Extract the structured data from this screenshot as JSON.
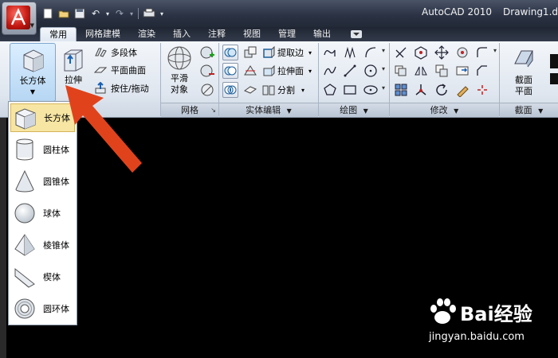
{
  "window": {
    "app_name": "AutoCAD 2010",
    "file_name": "Drawing1.d"
  },
  "ribbon_tabs": [
    "常用",
    "网格建模",
    "渲染",
    "插入",
    "注释",
    "视图",
    "管理",
    "输出"
  ],
  "modeling": {
    "box_label": "长方体",
    "extrude_label": "拉伸",
    "polysolid_label": "多段体",
    "planar_surface_label": "平面曲面",
    "presspull_label": "按住/拖动"
  },
  "mesh": {
    "smooth_line1": "平滑",
    "smooth_line2": "对象",
    "panel_title": "网格"
  },
  "solid_editing": {
    "extract_edges_label": "提取边",
    "extrude_faces_label": "拉伸面",
    "separate_label": "分割",
    "panel_title": "实体编辑"
  },
  "draw": {
    "panel_title": "绘图"
  },
  "modify": {
    "panel_title": "修改"
  },
  "section": {
    "line1": "截面",
    "line2": "平面",
    "panel_title": "截面"
  },
  "dropdown_items": [
    {
      "label": "长方体",
      "icon": "box-icon",
      "selected": true
    },
    {
      "label": "圆柱体",
      "icon": "cylinder-icon"
    },
    {
      "label": "圆锥体",
      "icon": "cone-icon"
    },
    {
      "label": "球体",
      "icon": "sphere-icon"
    },
    {
      "label": "棱锥体",
      "icon": "pyramid-icon"
    },
    {
      "label": "楔体",
      "icon": "wedge-icon"
    },
    {
      "label": "圆环体",
      "icon": "torus-icon"
    }
  ],
  "watermark": {
    "logo": "Bai经验",
    "url": "jingyan.baidu.com"
  },
  "colors": {
    "accent_red": "#e0431c",
    "selection": "#f7e6a3",
    "canvas": "#000000"
  }
}
